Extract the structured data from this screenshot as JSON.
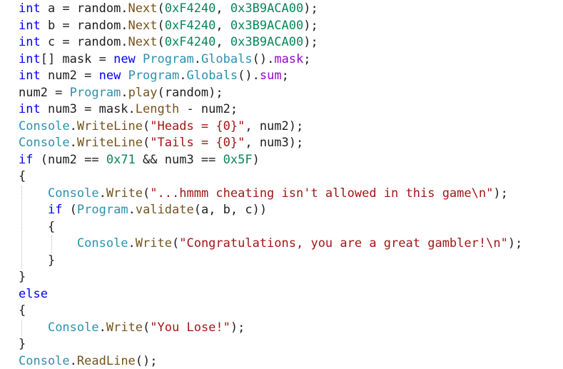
{
  "editor": {
    "language": "C#",
    "colors": {
      "background": "#ffffff",
      "keyword": "#0000ff",
      "type": "#2b91af",
      "method": "#74531f",
      "field": "#8f08c4",
      "string": "#a31515",
      "number": "#098658",
      "identifier": "#1e1e1e"
    },
    "lines": [
      {
        "tokens": [
          [
            "kw",
            "int"
          ],
          [
            "id",
            " a = random."
          ],
          [
            "fn",
            "Next"
          ],
          [
            "id",
            "("
          ],
          [
            "num",
            "0xF4240"
          ],
          [
            "id",
            ", "
          ],
          [
            "num",
            "0x3B9ACA00"
          ],
          [
            "id",
            ");"
          ]
        ]
      },
      {
        "tokens": [
          [
            "kw",
            "int"
          ],
          [
            "id",
            " b = random."
          ],
          [
            "fn",
            "Next"
          ],
          [
            "id",
            "("
          ],
          [
            "num",
            "0xF4240"
          ],
          [
            "id",
            ", "
          ],
          [
            "num",
            "0x3B9ACA00"
          ],
          [
            "id",
            ");"
          ]
        ]
      },
      {
        "tokens": [
          [
            "kw",
            "int"
          ],
          [
            "id",
            " c = random."
          ],
          [
            "fn",
            "Next"
          ],
          [
            "id",
            "("
          ],
          [
            "num",
            "0xF4240"
          ],
          [
            "id",
            ", "
          ],
          [
            "num",
            "0x3B9ACA00"
          ],
          [
            "id",
            ");"
          ]
        ]
      },
      {
        "tokens": [
          [
            "kw",
            "int"
          ],
          [
            "id",
            "[] mask = "
          ],
          [
            "kw",
            "new"
          ],
          [
            "id",
            " "
          ],
          [
            "ty",
            "Program"
          ],
          [
            "id",
            "."
          ],
          [
            "ty",
            "Globals"
          ],
          [
            "id",
            "()."
          ],
          [
            "fd",
            "mask"
          ],
          [
            "id",
            ";"
          ]
        ]
      },
      {
        "tokens": [
          [
            "kw",
            "int"
          ],
          [
            "id",
            " num2 = "
          ],
          [
            "kw",
            "new"
          ],
          [
            "id",
            " "
          ],
          [
            "ty",
            "Program"
          ],
          [
            "id",
            "."
          ],
          [
            "ty",
            "Globals"
          ],
          [
            "id",
            "()."
          ],
          [
            "fd",
            "sum"
          ],
          [
            "id",
            ";"
          ]
        ]
      },
      {
        "tokens": [
          [
            "id",
            "num2 = "
          ],
          [
            "ty",
            "Program"
          ],
          [
            "id",
            "."
          ],
          [
            "fn",
            "play"
          ],
          [
            "id",
            "(random);"
          ]
        ]
      },
      {
        "tokens": [
          [
            "kw",
            "int"
          ],
          [
            "id",
            " num3 = mask."
          ],
          [
            "fn",
            "Length"
          ],
          [
            "id",
            " - num2;"
          ]
        ]
      },
      {
        "tokens": [
          [
            "ty",
            "Console"
          ],
          [
            "id",
            "."
          ],
          [
            "fn",
            "WriteLine"
          ],
          [
            "id",
            "("
          ],
          [
            "str",
            "\"Heads = {0}\""
          ],
          [
            "id",
            ", num2);"
          ]
        ]
      },
      {
        "tokens": [
          [
            "ty",
            "Console"
          ],
          [
            "id",
            "."
          ],
          [
            "fn",
            "WriteLine"
          ],
          [
            "id",
            "("
          ],
          [
            "str",
            "\"Tails = {0}\""
          ],
          [
            "id",
            ", num3);"
          ]
        ]
      },
      {
        "tokens": [
          [
            "kw",
            "if"
          ],
          [
            "id",
            " (num2 == "
          ],
          [
            "num",
            "0x71"
          ],
          [
            "id",
            " && num3 == "
          ],
          [
            "num",
            "0x5F"
          ],
          [
            "id",
            ")"
          ]
        ]
      },
      {
        "tokens": [
          [
            "id",
            "{"
          ]
        ]
      },
      {
        "tokens": [
          [
            "id",
            "    "
          ],
          [
            "ty",
            "Console"
          ],
          [
            "id",
            "."
          ],
          [
            "fn",
            "Write"
          ],
          [
            "id",
            "("
          ],
          [
            "str",
            "\"...hmmm cheating isn't allowed in this game\\n\""
          ],
          [
            "id",
            ");"
          ]
        ]
      },
      {
        "tokens": [
          [
            "id",
            "    "
          ],
          [
            "kw",
            "if"
          ],
          [
            "id",
            " ("
          ],
          [
            "ty",
            "Program"
          ],
          [
            "id",
            "."
          ],
          [
            "fn",
            "validate"
          ],
          [
            "id",
            "(a, b, c))"
          ]
        ]
      },
      {
        "tokens": [
          [
            "id",
            "    {"
          ]
        ]
      },
      {
        "tokens": [
          [
            "id",
            "        "
          ],
          [
            "ty",
            "Console"
          ],
          [
            "id",
            "."
          ],
          [
            "fn",
            "Write"
          ],
          [
            "id",
            "("
          ],
          [
            "str",
            "\"Congratulations, you are a great gambler!\\n\""
          ],
          [
            "id",
            ");"
          ]
        ]
      },
      {
        "tokens": [
          [
            "id",
            "    }"
          ]
        ]
      },
      {
        "tokens": [
          [
            "id",
            "}"
          ]
        ]
      },
      {
        "tokens": [
          [
            "kw",
            "else"
          ]
        ]
      },
      {
        "tokens": [
          [
            "id",
            "{"
          ]
        ]
      },
      {
        "tokens": [
          [
            "id",
            "    "
          ],
          [
            "ty",
            "Console"
          ],
          [
            "id",
            "."
          ],
          [
            "fn",
            "Write"
          ],
          [
            "id",
            "("
          ],
          [
            "str",
            "\"You Lose!\""
          ],
          [
            "id",
            ");"
          ]
        ]
      },
      {
        "tokens": [
          [
            "id",
            "}"
          ]
        ]
      },
      {
        "tokens": [
          [
            "ty",
            "Console"
          ],
          [
            "id",
            "."
          ],
          [
            "fn",
            "ReadLine"
          ],
          [
            "id",
            "();"
          ]
        ]
      }
    ]
  }
}
